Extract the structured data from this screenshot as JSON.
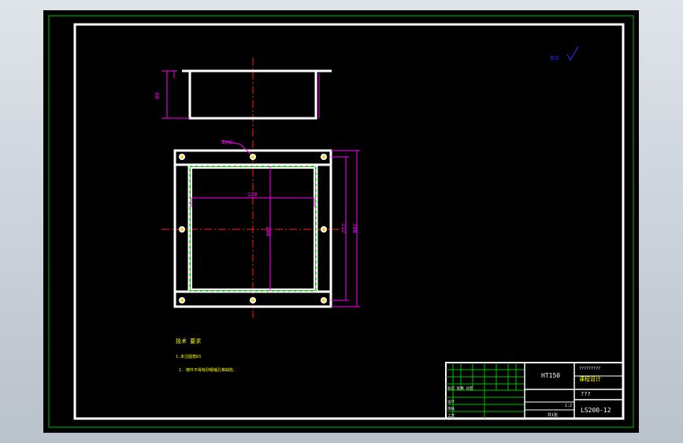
{
  "dimensions": {
    "top_view_height": "80",
    "leader_callout": "4xM6",
    "inner_width": "220",
    "outer_height_1": "212",
    "outer_height_2": "300",
    "inner_height": "200"
  },
  "tech_requirements": {
    "title": "技术 要求",
    "line1": "1.未注圆角R3",
    "line2": "2. 铸件不得有砂眼缩孔等缺陷."
  },
  "roughness_mark": "其余",
  "title_block": {
    "material": "HT150",
    "drawing_number": "LS200-12",
    "name": "???",
    "school_top": "?????????",
    "school_bottom": "课程设计",
    "scale": "1:2",
    "sheet": "共1张",
    "row_labels": [
      "标记 处数 分区",
      "设计",
      "审核",
      "工艺"
    ]
  },
  "colors": {
    "background": "#000000",
    "border": "#ffffff",
    "outer_frame": "#00c000",
    "dimension": "#ff00ff",
    "centerline": "#ff2020",
    "annotation": "#ffff00",
    "hidden_edge": "#00ff00",
    "roughness": "#3030ff"
  }
}
